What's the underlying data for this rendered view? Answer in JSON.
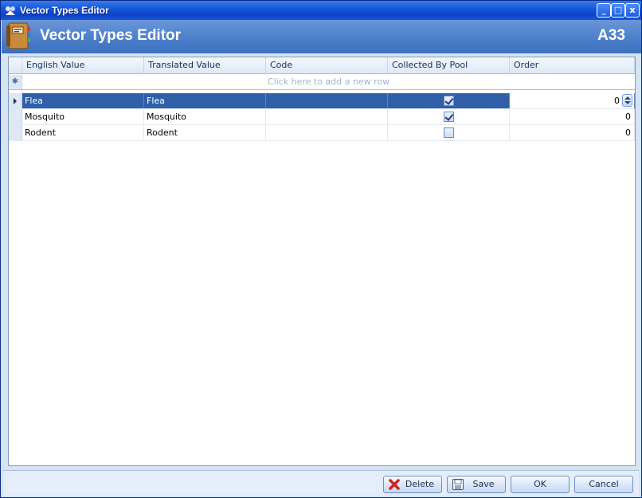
{
  "window": {
    "title": "Vector Types Editor",
    "controls": {
      "minimize": "_",
      "maximize": "□",
      "close": "x"
    }
  },
  "header": {
    "title": "Vector Types Editor",
    "code": "A33",
    "icon": "address-book-icon"
  },
  "grid": {
    "columns": [
      "English Value",
      "Translated Value",
      "Code",
      "Collected By Pool",
      "Order"
    ],
    "new_row_hint": "Click here to add a new row",
    "new_row_symbol": "✱",
    "rows": [
      {
        "english": "Flea",
        "translated": "Flea",
        "code": "",
        "collected_by_pool": true,
        "order": "0",
        "selected": true
      },
      {
        "english": "Mosquito",
        "translated": "Mosquito",
        "code": "",
        "collected_by_pool": true,
        "order": "0",
        "selected": false
      },
      {
        "english": "Rodent",
        "translated": "Rodent",
        "code": "",
        "collected_by_pool": false,
        "order": "0",
        "selected": false
      }
    ]
  },
  "footer": {
    "delete_label": "Delete",
    "save_label": "Save",
    "ok_label": "OK",
    "cancel_label": "Cancel"
  },
  "colors": {
    "selection": "#2f5fa8",
    "titlebar": "#1458dc",
    "header": "#4f82cc"
  }
}
